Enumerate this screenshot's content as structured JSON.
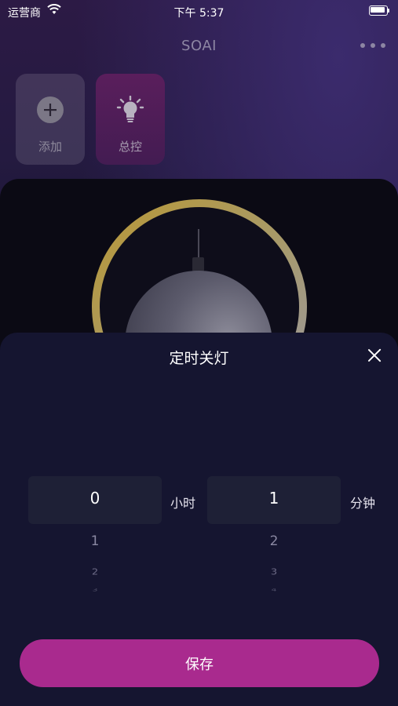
{
  "status_bar": {
    "carrier": "运营商",
    "time": "下午 5:37"
  },
  "nav": {
    "title": "SOAI",
    "more_icon": "more-dots-icon"
  },
  "tiles": [
    {
      "label": "添加",
      "icon": "plus-circle-icon"
    },
    {
      "label": "总控",
      "icon": "lightbulb-icon"
    }
  ],
  "colors": {
    "accent": "#a92a8e",
    "ring": "#c9a84a",
    "sheet_bg": "#151530"
  },
  "timer_sheet": {
    "title": "定时关灯",
    "close_icon": "close-icon",
    "hours": {
      "selected": "0",
      "unit": "小时",
      "options": [
        "1",
        "2",
        "3"
      ]
    },
    "minutes": {
      "selected": "1",
      "unit": "分钟",
      "options": [
        "2",
        "3",
        "4"
      ]
    },
    "save_label": "保存"
  }
}
